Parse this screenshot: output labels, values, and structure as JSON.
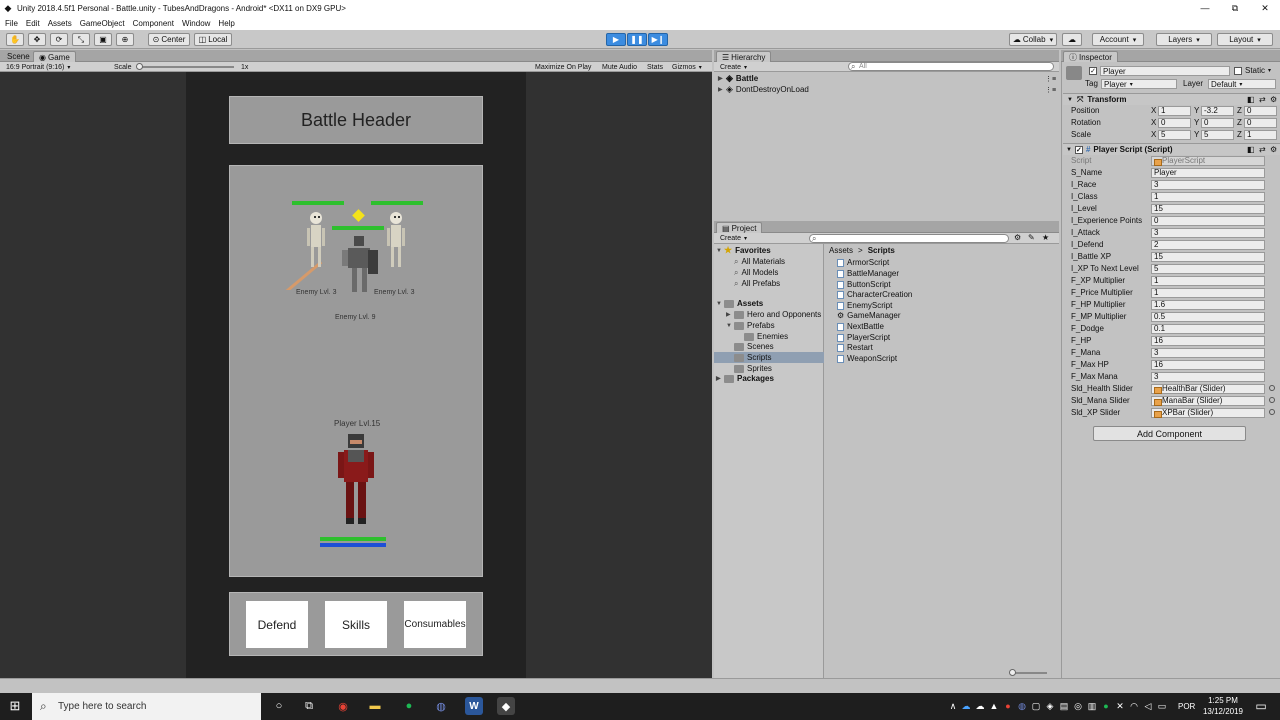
{
  "window": {
    "title": "Unity 2018.4.5f1 Personal - Battle.unity - TubesAndDragons - Android* <DX11 on DX9 GPU>",
    "minimize": "—",
    "maximize": "⧉",
    "close": "✕"
  },
  "menu": [
    "File",
    "Edit",
    "Assets",
    "GameObject",
    "Component",
    "Window",
    "Help"
  ],
  "toolbar": {
    "pivot": "Center",
    "space": "Local",
    "collab": "Collab",
    "account": "Account",
    "layers": "Layers",
    "layout": "Layout"
  },
  "scene": {
    "tabs": [
      "Scene",
      "Game"
    ],
    "aspect": "16:9 Portrait (9:16)",
    "scale_label": "Scale",
    "scale_value": "1x",
    "options": [
      "Maximize On Play",
      "Mute Audio",
      "Stats",
      "Gizmos"
    ]
  },
  "game": {
    "header": "Battle Header",
    "enemies": [
      {
        "label": "Enemy Lvl. 3",
        "hp": 1.0
      },
      {
        "label": "Enemy Lvl. 3",
        "hp": 1.0
      },
      {
        "label": "Enemy Lvl. 9",
        "hp": 1.0
      }
    ],
    "player_label": "Player Lvl.15",
    "player_hp": 1.0,
    "player_mp": 1.0,
    "buttons": {
      "defend": "Defend",
      "skills": "Skills",
      "consumables": "Consumables"
    }
  },
  "hierarchy": {
    "tab": "Hierarchy",
    "create": "Create",
    "search_placeholder": "All",
    "items": [
      "Battle",
      "DontDestroyOnLoad"
    ]
  },
  "project": {
    "tab": "Project",
    "create": "Create",
    "favorites": "Favorites",
    "favorite_items": [
      "All Materials",
      "All Models",
      "All Prefabs"
    ],
    "assets": "Assets",
    "asset_folders": [
      "Hero and Opponents",
      "Prefabs",
      "Enemies",
      "Scenes",
      "Scripts",
      "Sprites"
    ],
    "packages": "Packages",
    "breadcrumb": [
      "Assets",
      "Scripts"
    ],
    "breadcrumb_sep": ">",
    "scripts": [
      "ArmorScript",
      "BattleManager",
      "ButtonScript",
      "CharacterCreation",
      "EnemyScript",
      "GameManager",
      "NextBattle",
      "PlayerScript",
      "Restart",
      "WeaponScript"
    ]
  },
  "inspector": {
    "tab": "Inspector",
    "object_name": "Player",
    "static_label": "Static",
    "tag_label": "Tag",
    "tag_value": "Player",
    "layer_label": "Layer",
    "layer_value": "Default",
    "transform": {
      "title": "Transform",
      "rows": [
        {
          "label": "Position",
          "x": "1",
          "y": "-3.2",
          "z": "0"
        },
        {
          "label": "Rotation",
          "x": "0",
          "y": "0",
          "z": "0"
        },
        {
          "label": "Scale",
          "x": "5",
          "y": "5",
          "z": "1"
        }
      ],
      "axes": [
        "X",
        "Y",
        "Z"
      ]
    },
    "script": {
      "title": "Player Script (Script)",
      "script_label": "Script",
      "script_value": "PlayerScript",
      "fields": [
        {
          "label": "S_Name",
          "value": "Player"
        },
        {
          "label": "I_Race",
          "value": "3"
        },
        {
          "label": "I_Class",
          "value": "1"
        },
        {
          "label": "I_Level",
          "value": "15"
        },
        {
          "label": "I_Experience Points",
          "value": "0"
        },
        {
          "label": "I_Attack",
          "value": "3"
        },
        {
          "label": "I_Defend",
          "value": "2"
        },
        {
          "label": "I_Battle XP",
          "value": "15"
        },
        {
          "label": "I_XP To Next Level",
          "value": "5"
        },
        {
          "label": "F_XP Multiplier",
          "value": "1"
        },
        {
          "label": "F_Price Multiplier",
          "value": "1"
        },
        {
          "label": "F_HP Multiplier",
          "value": "1.6"
        },
        {
          "label": "F_MP Multiplier",
          "value": "0.5"
        },
        {
          "label": "F_Dodge",
          "value": "0.1"
        },
        {
          "label": "F_HP",
          "value": "16"
        },
        {
          "label": "F_Mana",
          "value": "3"
        },
        {
          "label": "F_Max HP",
          "value": "16"
        },
        {
          "label": "F_Max Mana",
          "value": "3"
        }
      ],
      "sliders": [
        {
          "label": "Sld_Health Slider",
          "value": "HealthBar (Slider)"
        },
        {
          "label": "Sld_Mana Slider",
          "value": "ManaBar (Slider)"
        },
        {
          "label": "Sld_XP Slider",
          "value": "XPBar (Slider)"
        }
      ]
    },
    "add_component": "Add Component"
  },
  "taskbar": {
    "search_placeholder": "Type here to search",
    "lang": "POR",
    "time": "1:25 PM",
    "date": "13/12/2019"
  },
  "colors": {
    "hp": "#2ec02e",
    "mp": "#1e4fd6",
    "accent": "#3c8ce0"
  }
}
